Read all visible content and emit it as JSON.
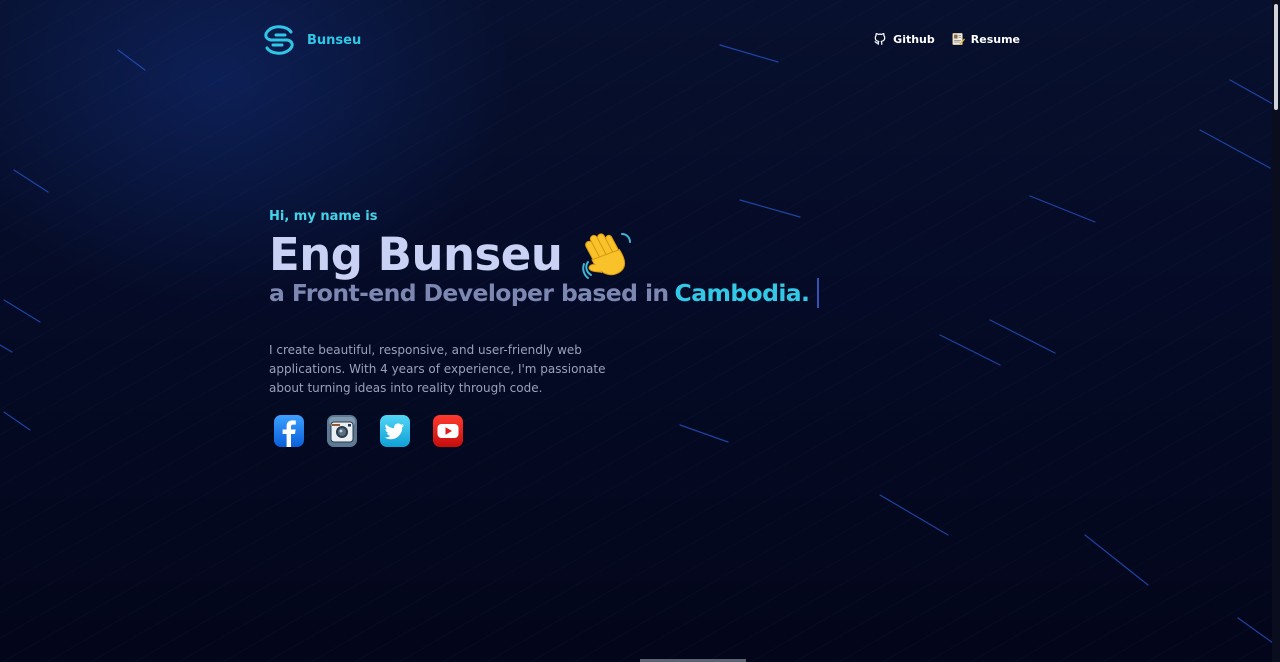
{
  "header": {
    "brand_name": "Bunseu",
    "nav": [
      {
        "label": "Github",
        "icon": "github-icon"
      },
      {
        "label": "Resume",
        "icon": "resume-icon"
      }
    ]
  },
  "hero": {
    "greeting": "Hi, my name is",
    "name": "Eng Bunseu",
    "wave_icon": "waving-hand-icon",
    "tagline": "a Front-end Developer based in",
    "country": "Cambodia.",
    "bio": "I create beautiful, responsive, and user-friendly web applications. With 4 years of experience, I'm passionate about turning ideas into reality through code."
  },
  "socials": [
    {
      "name": "facebook",
      "icon": "facebook-icon",
      "color": "#1877f2"
    },
    {
      "name": "instagram",
      "icon": "instagram-icon",
      "color": "#5d7a94"
    },
    {
      "name": "twitter",
      "icon": "twitter-icon",
      "color": "#1fb5e6"
    },
    {
      "name": "youtube",
      "icon": "youtube-icon",
      "color": "#e01e1e"
    }
  ],
  "colors": {
    "accent": "#2ec7e8",
    "background": "#03061a",
    "name_text": "#c9d2f5",
    "tagline_text": "#7c87b2",
    "body_text": "#9aa0b8"
  }
}
